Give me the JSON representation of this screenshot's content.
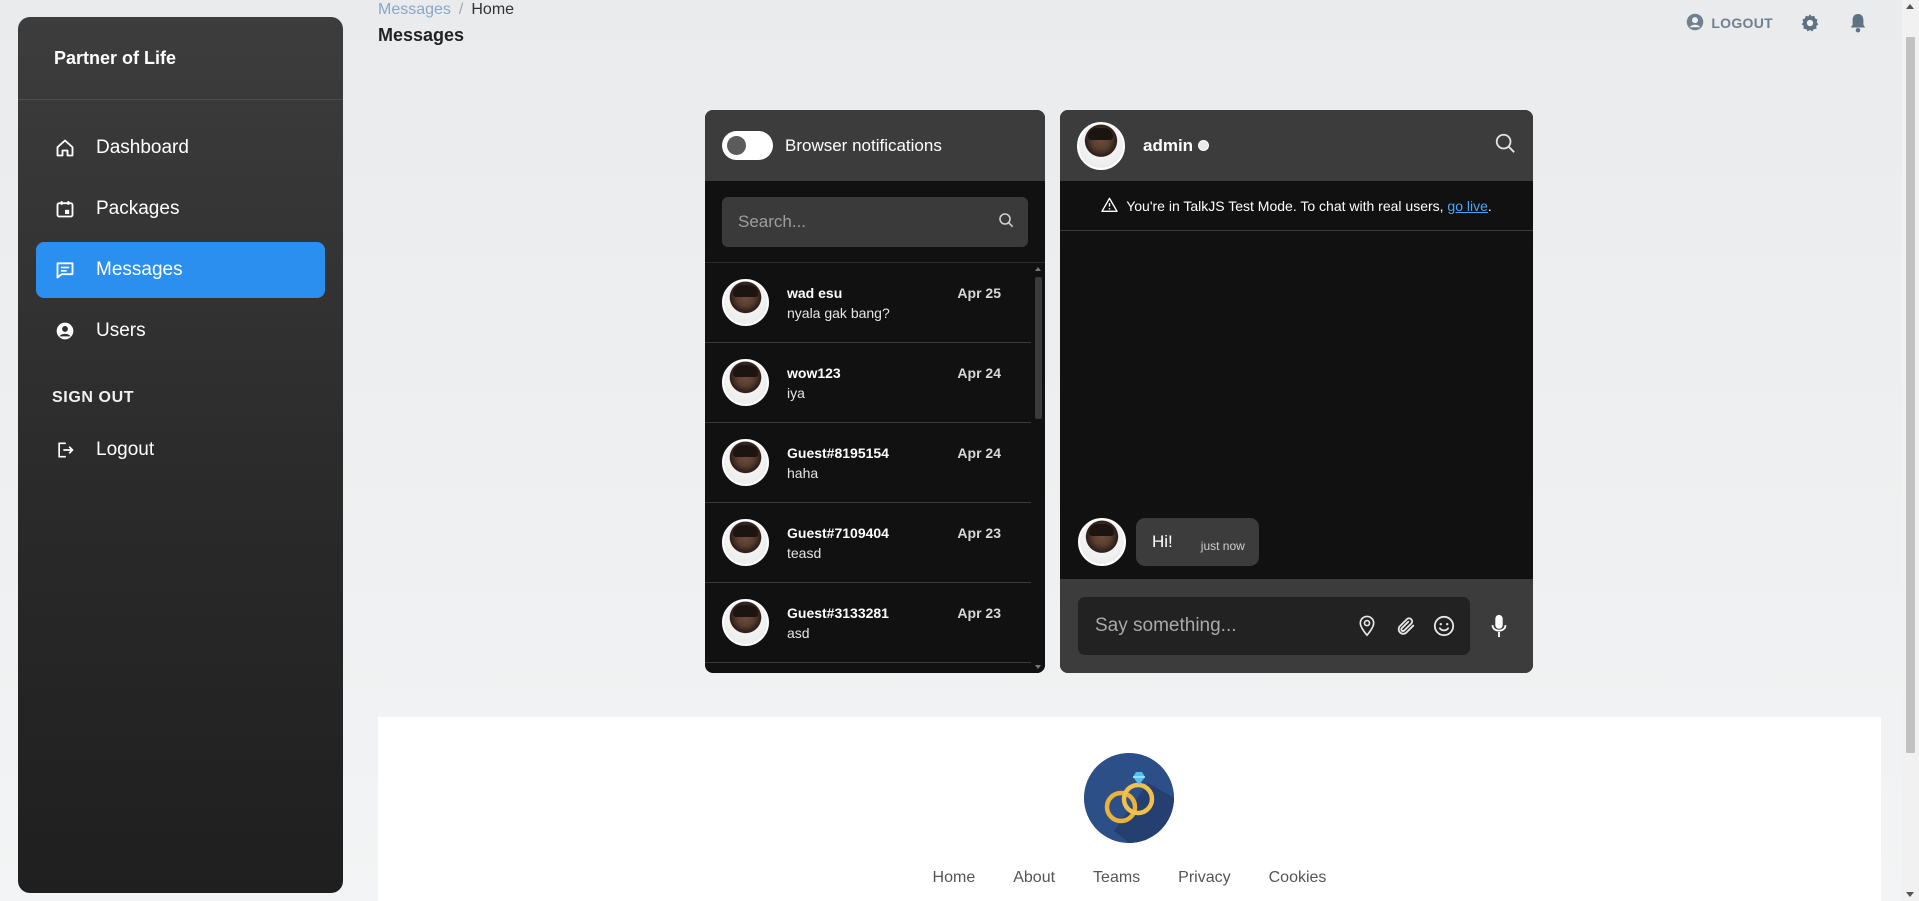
{
  "sidebar": {
    "brand": "Partner of Life",
    "items": [
      {
        "label": "Dashboard",
        "icon": "home-icon"
      },
      {
        "label": "Packages",
        "icon": "calendar-icon"
      },
      {
        "label": "Messages",
        "icon": "chat-icon",
        "active": true
      },
      {
        "label": "Users",
        "icon": "user-circle-icon"
      }
    ],
    "section_label": "SIGN OUT",
    "logout_label": "Logout"
  },
  "header": {
    "breadcrumb_link": "Messages",
    "breadcrumb_separator": "/",
    "breadcrumb_current": "Home",
    "title": "Messages",
    "logout_label": "LOGOUT"
  },
  "inbox": {
    "notifications_label": "Browser notifications",
    "search_placeholder": "Search...",
    "conversations": [
      {
        "name": "wad esu",
        "date": "Apr 25",
        "message": "nyala gak bang?"
      },
      {
        "name": "wow123",
        "date": "Apr 24",
        "message": "iya"
      },
      {
        "name": "Guest#8195154",
        "date": "Apr 24",
        "message": "haha"
      },
      {
        "name": "Guest#7109404",
        "date": "Apr 23",
        "message": "teasd"
      },
      {
        "name": "Guest#3133281",
        "date": "Apr 23",
        "message": "asd"
      }
    ]
  },
  "chat": {
    "user_name": "admin",
    "banner_text": "You're in TalkJS Test Mode. To chat with real users,",
    "banner_link": "go live",
    "banner_end": ".",
    "message_text": "Hi!",
    "message_time": "just now",
    "composer_placeholder": "Say something..."
  },
  "footer": {
    "links": [
      "Home",
      "About",
      "Teams",
      "Privacy",
      "Cookies"
    ]
  },
  "colors": {
    "accent": "#2b8ff0",
    "sidebar_bg": "#2e2e2e",
    "panel_header": "#3c3c3c",
    "panel_bg": "#111111",
    "link": "#4aa3ff"
  }
}
